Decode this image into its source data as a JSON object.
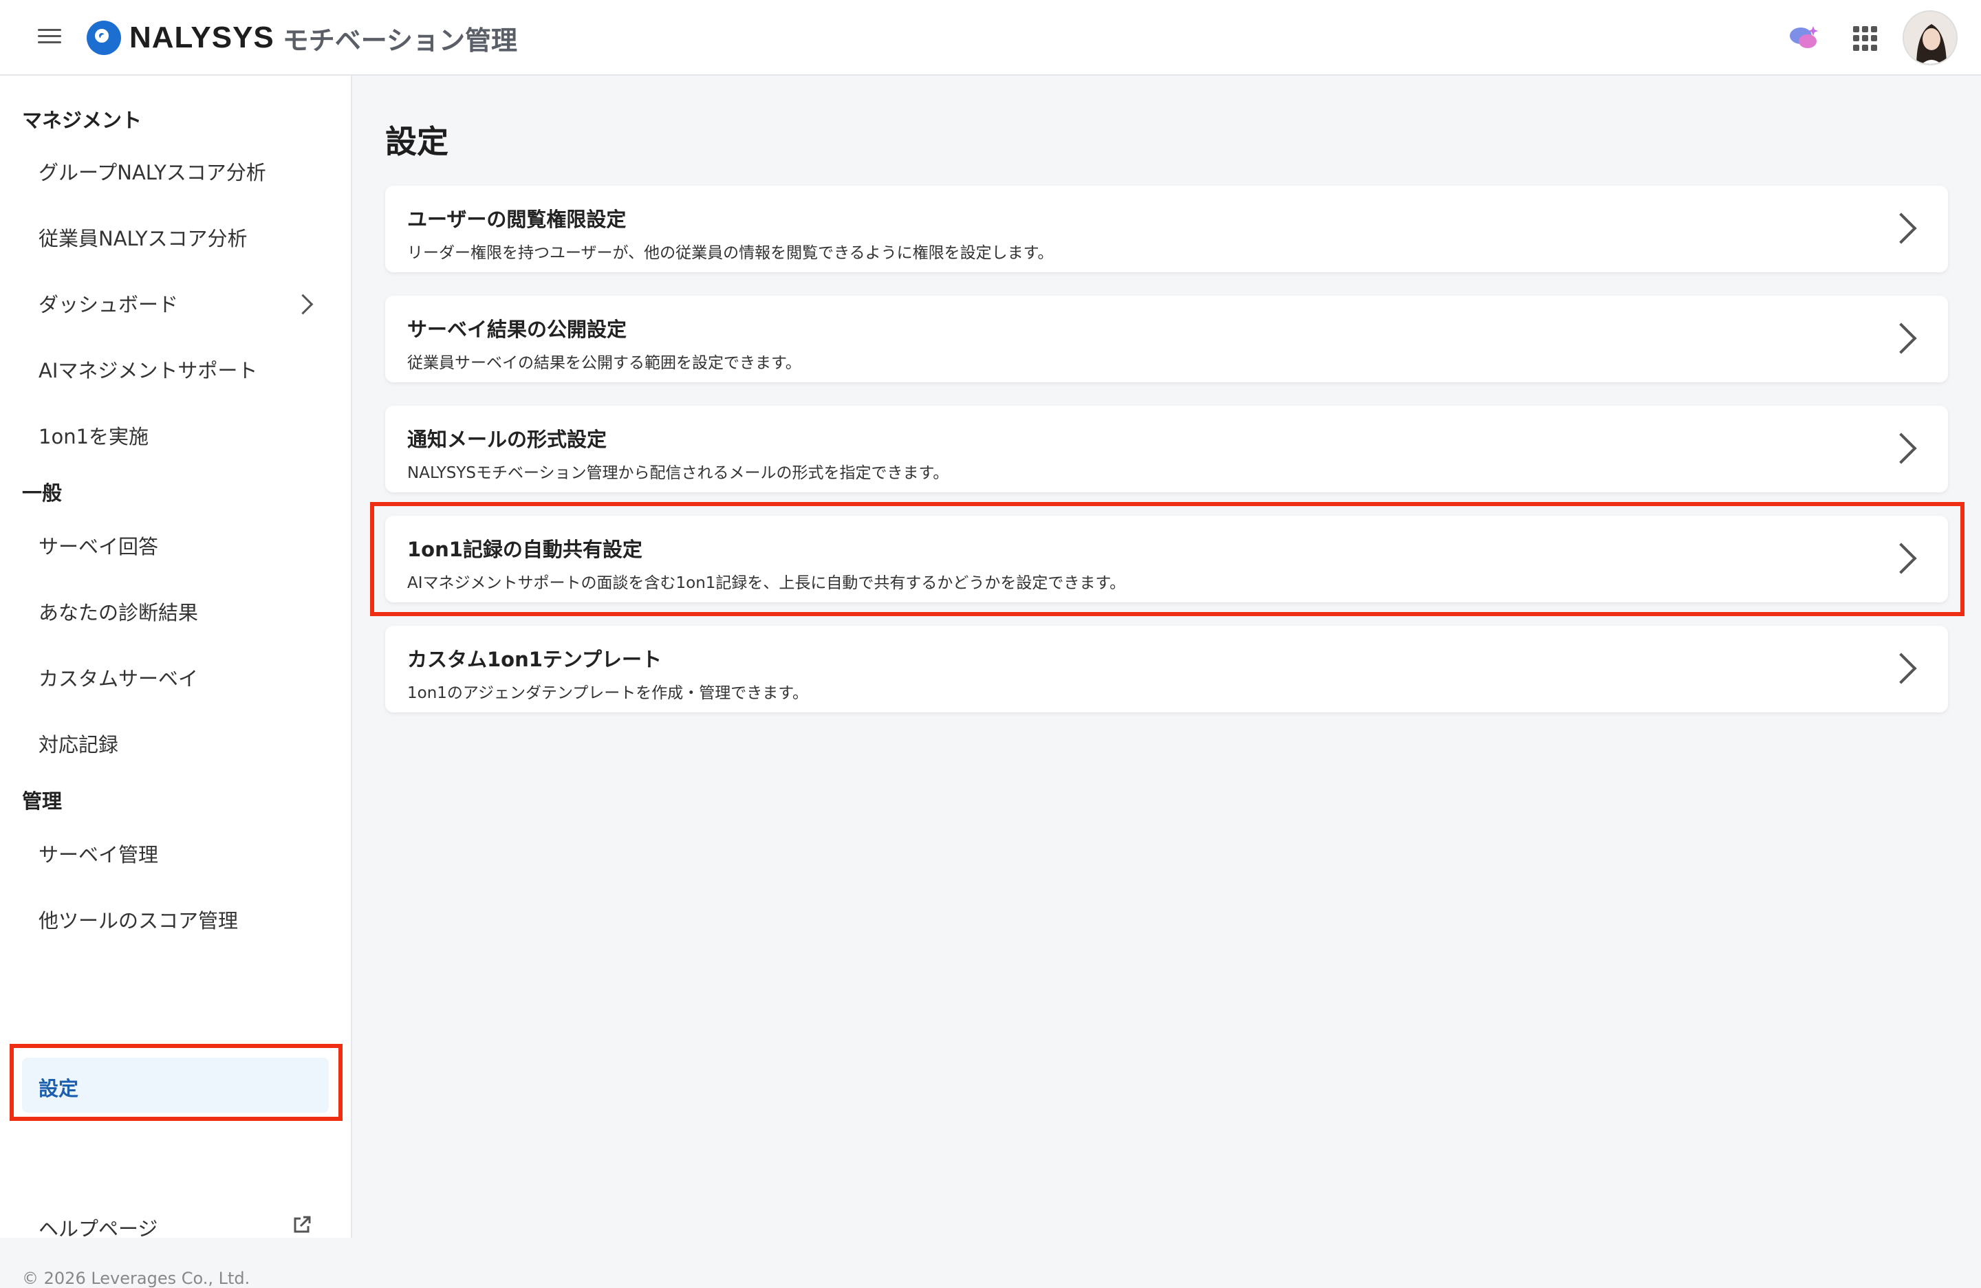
{
  "header": {
    "brand": "NALYSYS",
    "product": "モチベーション管理",
    "icons": [
      "menu-icon",
      "chat-sparkle-icon",
      "apps-grid-icon",
      "avatar"
    ]
  },
  "sidebar": {
    "sections": [
      {
        "title": "マネジメント",
        "items": [
          "グループNALYスコア分析",
          "従業員NALYスコア分析",
          "ダッシュボード",
          "AIマネジメントサポート",
          "1on1を実施"
        ]
      },
      {
        "title": "一般",
        "items": [
          "サーベイ回答",
          "あなたの診断結果",
          "カスタムサーベイ",
          "対応記録"
        ]
      },
      {
        "title": "管理",
        "items": [
          "サーベイ管理",
          "他ツールのスコア管理"
        ]
      }
    ],
    "settings_label": "設定",
    "help_label": "ヘルプページ",
    "copyright": "© 2026 Leverages Co., Ltd."
  },
  "main": {
    "title": "設定",
    "cards": [
      {
        "title": "ユーザーの閲覧権限設定",
        "desc": "リーダー権限を持つユーザーが、他の従業員の情報を閲覧できるように権限を設定します。"
      },
      {
        "title": "サーベイ結果の公開設定",
        "desc": "従業員サーベイの結果を公開する範囲を設定できます。"
      },
      {
        "title": "通知メールの形式設定",
        "desc": "NALYSYSモチベーション管理から配信されるメールの形式を指定できます。"
      },
      {
        "title": "1on1記録の自動共有設定",
        "desc": "AIマネジメントサポートの面談を含む1on1記録を、上長に自動で共有するかどうかを設定できます。"
      },
      {
        "title": "カスタム1on1テンプレート",
        "desc": "1on1のアジェンダテンプレートを作成・管理できます。"
      }
    ]
  },
  "colors": {
    "accent": "#1c6fd1",
    "highlight": "#ef2d12",
    "active_bg": "#eef6fd"
  }
}
